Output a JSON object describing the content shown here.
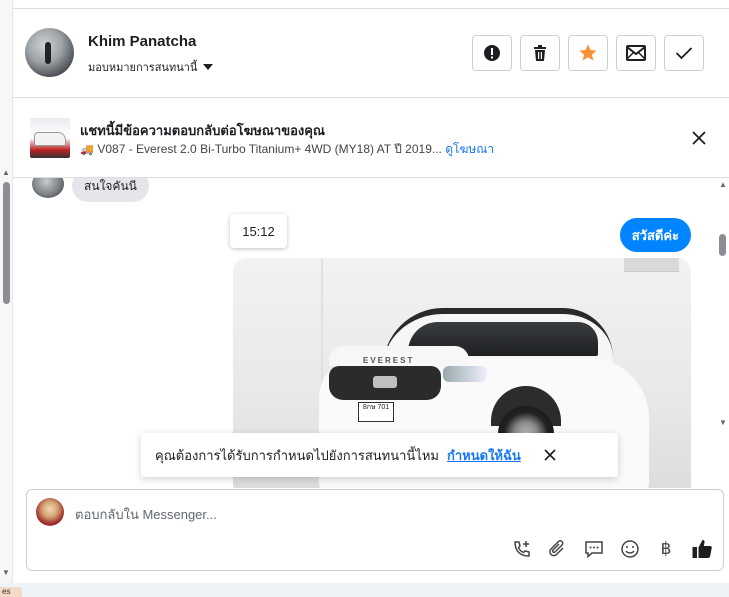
{
  "header": {
    "contact_name": "Khim Panatcha",
    "assign_label": "มอบหมายการสนทนานี้",
    "actions": [
      "spam-icon",
      "trash-icon",
      "star-icon",
      "mail-icon",
      "check-icon"
    ],
    "star_color": "#f7923a"
  },
  "ad": {
    "title": "แชทนี้มีข้อความตอบกลับต่อโฆษณาของคุณ",
    "subtitle": "V087 - Everest 2.0 Bi-Turbo Titanium+ 4WD (MY18) AT ปี 2019...",
    "link": "ดูโฆษณา"
  },
  "messages": {
    "incoming_text": "สนใจคันนี",
    "timestamp": "15:12",
    "outgoing_text": "สวัสดีค่ะ",
    "outgoing_color": "#0084ff",
    "photo_badge": "EVEREST",
    "photo_plate": "8กษ 701"
  },
  "notice": {
    "text": "คุณต้องการได้รับการกำหนดไปยังการสนทนานี้ไหม",
    "link": "กำหนดให้ฉัน"
  },
  "composer": {
    "placeholder": "ตอบกลับใน Messenger...",
    "tools": [
      "call-add-icon",
      "attach-icon",
      "saved-reply-icon",
      "emoji-icon",
      "baht-icon",
      "like-icon"
    ],
    "baht_symbol": "฿"
  },
  "bottom_tag": "es"
}
